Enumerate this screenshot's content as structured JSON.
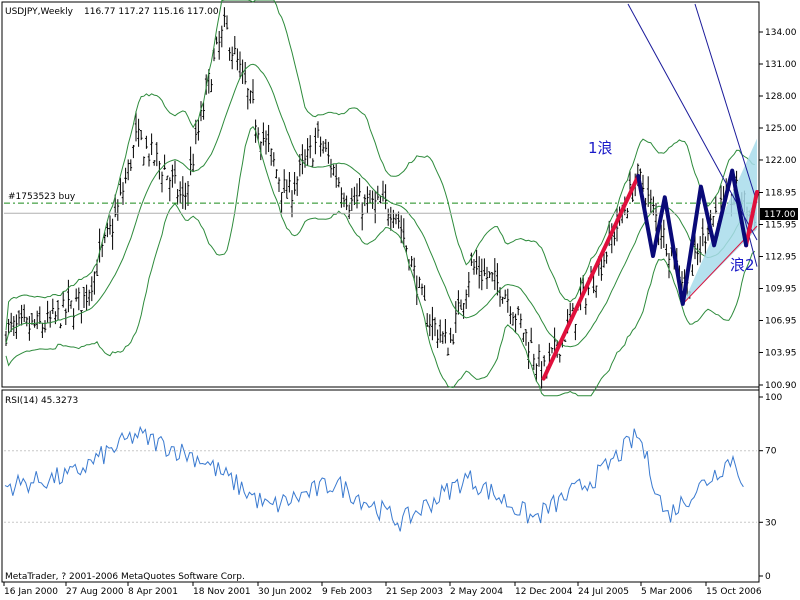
{
  "header": {
    "symbol_tf": "USDJPY,Weekly",
    "ohlc": "116.77 117.27 115.16 117.00"
  },
  "price_axis": {
    "ticks": [
      "134.00",
      "131.00",
      "128.00",
      "125.00",
      "122.00",
      "118.95",
      "115.95",
      "112.95",
      "109.95",
      "106.95",
      "103.95",
      "100.90"
    ],
    "current_price": "117.00"
  },
  "order_line": {
    "label": "#1753523 buy",
    "price": 117.95
  },
  "annotations": {
    "wave1": "1浪",
    "wave2": "浪2"
  },
  "rsi": {
    "label": "RSI(14) 45.3273",
    "ticks": [
      "100",
      "70",
      "30",
      "0"
    ]
  },
  "date_axis": {
    "labels": [
      "16 Jan 2000",
      "27 Aug 2000",
      "8 Apr 2001",
      "18 Nov 2001",
      "30 Jun 2002",
      "9 Feb 2003",
      "21 Sep 2003",
      "2 May 2004",
      "12 Dec 2004",
      "24 Jul 2005",
      "5 Mar 2006",
      "15 Oct 2006"
    ]
  },
  "copyright": "MetaTrader, ? 2001-2006 MetaQuotes Software Corp.",
  "colors": {
    "bars": "#000000",
    "bollinger": "#2e8b3c",
    "order_line": "#1a8a1a",
    "wave_red": "#e0103c",
    "wave_navy": "#0a0a78",
    "channel_fill": "#a8dceb",
    "fan_lines": "#1a1a9a",
    "rsi_line": "#3a7ad0",
    "price_label_bg": "#000000"
  },
  "chart_data": {
    "type": "candlestick",
    "title": "USDJPY,Weekly",
    "series_price_keypoints": [
      {
        "date": "2000-01-16",
        "price": 106.0
      },
      {
        "date": "2000-06-01",
        "price": 106.5
      },
      {
        "date": "2000-10-15",
        "price": 109.0
      },
      {
        "date": "2001-02-01",
        "price": 117.0
      },
      {
        "date": "2001-04-08",
        "price": 124.0
      },
      {
        "date": "2001-07-15",
        "price": 121.0
      },
      {
        "date": "2001-09-15",
        "price": 118.0
      },
      {
        "date": "2001-12-15",
        "price": 130.0
      },
      {
        "date": "2002-02-01",
        "price": 134.5
      },
      {
        "date": "2002-05-15",
        "price": 126.0
      },
      {
        "date": "2002-09-01",
        "price": 118.5
      },
      {
        "date": "2002-12-15",
        "price": 124.0
      },
      {
        "date": "2003-04-01",
        "price": 118.0
      },
      {
        "date": "2003-09-01",
        "price": 117.5
      },
      {
        "date": "2003-12-15",
        "price": 107.5
      },
      {
        "date": "2004-03-01",
        "price": 104.5
      },
      {
        "date": "2004-05-15",
        "price": 112.0
      },
      {
        "date": "2004-09-01",
        "price": 110.0
      },
      {
        "date": "2005-01-15",
        "price": 102.0
      },
      {
        "date": "2005-05-01",
        "price": 107.5
      },
      {
        "date": "2005-07-24",
        "price": 112.0
      },
      {
        "date": "2005-12-01",
        "price": 120.5
      },
      {
        "date": "2006-02-01",
        "price": 116.5
      },
      {
        "date": "2006-05-15",
        "price": 110.0
      },
      {
        "date": "2006-08-01",
        "price": 116.5
      },
      {
        "date": "2006-11-01",
        "price": 119.0
      },
      {
        "date": "2006-12-15",
        "price": 117.0
      }
    ],
    "wave_lines": [
      {
        "name": "red",
        "points": [
          {
            "date": "2005-01-15",
            "price": 101.5
          },
          {
            "date": "2005-12-01",
            "price": 120.5
          }
        ]
      },
      {
        "name": "red-right",
        "points": [
          {
            "date": "2006-12-01",
            "price": 114.0
          },
          {
            "date": "2007-01-07",
            "price": 119.0
          }
        ]
      },
      {
        "name": "navy",
        "points": [
          {
            "date": "2005-12-01",
            "price": 120.5
          },
          {
            "date": "2006-01-20",
            "price": 113.0
          },
          {
            "date": "2006-03-01",
            "price": 118.5
          },
          {
            "date": "2006-05-01",
            "price": 108.5
          },
          {
            "date": "2006-07-01",
            "price": 119.5
          },
          {
            "date": "2006-08-15",
            "price": 114.0
          },
          {
            "date": "2006-10-15",
            "price": 121.0
          },
          {
            "date": "2006-12-01",
            "price": 114.0
          }
        ]
      }
    ],
    "rsi_keypoints": [
      {
        "date": "2000-01-16",
        "value": 50
      },
      {
        "date": "2000-08-27",
        "value": 56
      },
      {
        "date": "2001-04-08",
        "value": 79
      },
      {
        "date": "2001-11-18",
        "value": 65
      },
      {
        "date": "2002-06-30",
        "value": 38
      },
      {
        "date": "2003-02-09",
        "value": 52
      },
      {
        "date": "2003-09-21",
        "value": 30
      },
      {
        "date": "2004-05-02",
        "value": 55
      },
      {
        "date": "2004-12-12",
        "value": 32
      },
      {
        "date": "2005-07-24",
        "value": 57
      },
      {
        "date": "2005-12-01",
        "value": 79
      },
      {
        "date": "2006-03-05",
        "value": 33
      },
      {
        "date": "2006-10-15",
        "value": 66
      },
      {
        "date": "2006-12-20",
        "value": 45
      }
    ],
    "price_range": [
      100.9,
      134.0
    ],
    "rsi_range": [
      0,
      100
    ]
  }
}
